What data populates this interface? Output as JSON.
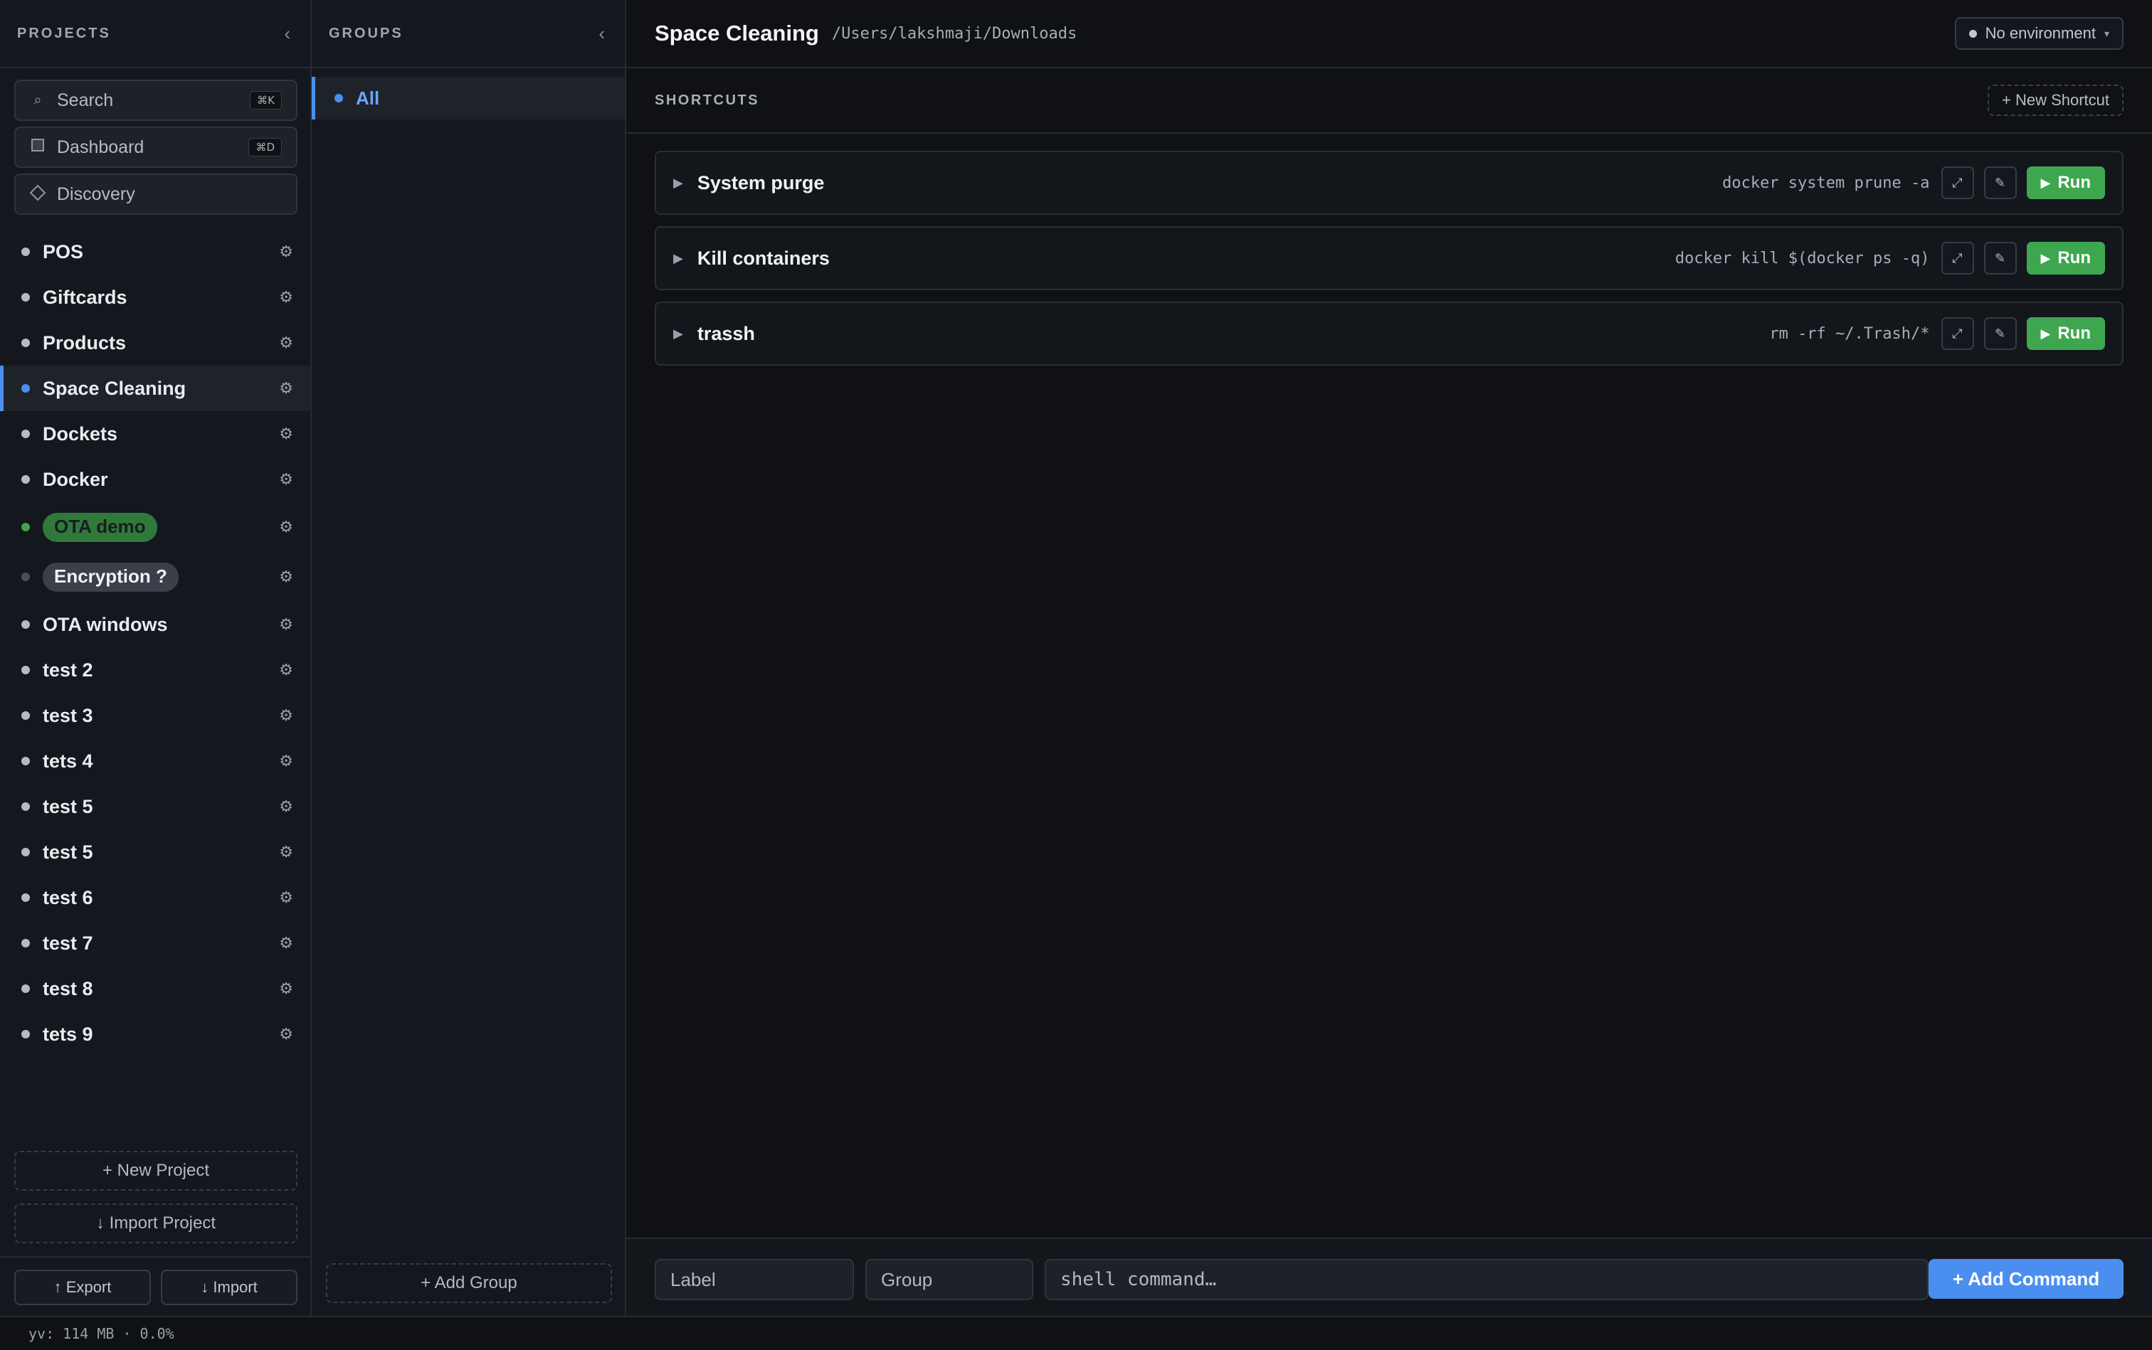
{
  "projects_panel": {
    "title": "PROJECTS",
    "collapse_icon": "‹",
    "search": {
      "label": "Search",
      "shortcut": "⌘K"
    },
    "dashboard": {
      "label": "Dashboard",
      "shortcut": "⌘D"
    },
    "discovery": {
      "label": "Discovery"
    },
    "items": [
      {
        "name": "POS"
      },
      {
        "name": "Giftcards"
      },
      {
        "name": "Products"
      },
      {
        "name": "Space Cleaning"
      },
      {
        "name": "Dockets"
      },
      {
        "name": "Docker"
      },
      {
        "name": "OTA demo"
      },
      {
        "name": "Encryption ?"
      },
      {
        "name": "OTA windows"
      },
      {
        "name": "test 2"
      },
      {
        "name": "test 3"
      },
      {
        "name": "tets 4"
      },
      {
        "name": "test 5"
      },
      {
        "name": "test 5"
      },
      {
        "name": "test 6"
      },
      {
        "name": "test 7"
      },
      {
        "name": "test 8"
      },
      {
        "name": "tets 9"
      }
    ],
    "gear_icon": "⚙",
    "new_project": "+ New Project",
    "import_project": "↓ Import Project",
    "export": "↑ Export",
    "import": "↓ Import"
  },
  "groups_panel": {
    "title": "GROUPS",
    "collapse_icon": "‹",
    "items": [
      {
        "name": "All"
      }
    ],
    "add_group": "+ Add Group"
  },
  "main": {
    "title": "Space Cleaning",
    "path": "/Users/lakshmaji/Downloads",
    "environment": "No environment",
    "shortcuts_title": "SHORTCUTS",
    "new_shortcut": "+ New Shortcut",
    "shortcuts": [
      {
        "name": "System purge",
        "command": "docker system prune -a"
      },
      {
        "name": "Kill containers",
        "command": "docker kill $(docker ps -q)"
      },
      {
        "name": "trassh",
        "command": "rm -rf ~/.Trash/*"
      }
    ],
    "run_label": "Run",
    "expand_glyph": "⤢",
    "edit_glyph": "✎",
    "add_bar": {
      "label_placeholder": "Label",
      "group_placeholder": "Group",
      "command_placeholder": "shell command…",
      "add_button": "+ Add Command"
    }
  },
  "status_bar": {
    "text": "yv: 114 MB · 0.0%"
  },
  "colors": {
    "accent": "#4a8ff0",
    "run_green": "#3fa650",
    "ota_demo_pill_bg": "#2f7a3a",
    "ota_demo_pill_text": "#1a1d22",
    "encryption_pill_bg": "#3a3f49",
    "ota_demo_dot": "#3fa650",
    "encryption_dot": "#4a4f58"
  }
}
